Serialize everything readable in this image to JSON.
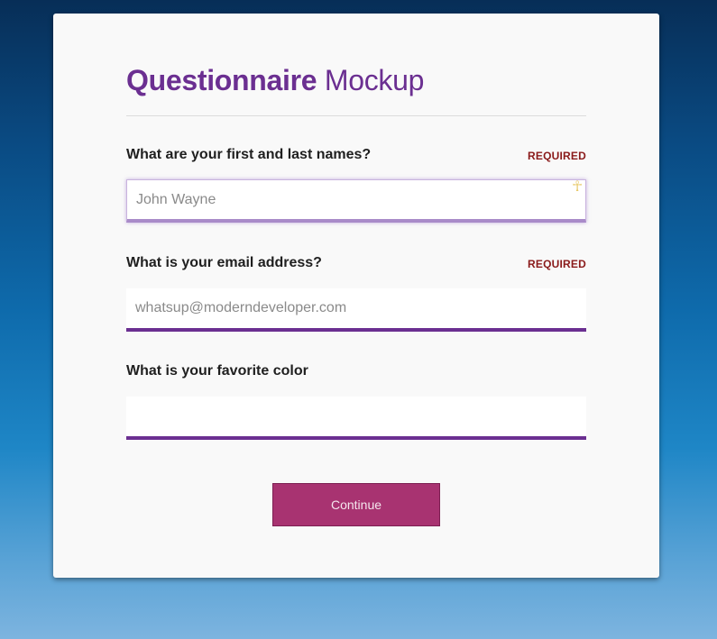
{
  "form": {
    "title_bold": "Questionnaire",
    "title_light": "Mockup",
    "questions": [
      {
        "label": "What are your first and last names?",
        "required_label": "REQUIRED",
        "placeholder": "John Wayne",
        "value": ""
      },
      {
        "label": "What is your email address?",
        "required_label": "REQUIRED",
        "placeholder": "whatsup@moderndeveloper.com",
        "value": ""
      },
      {
        "label": "What is your favorite color",
        "placeholder": "",
        "value": ""
      }
    ],
    "continue_label": "Continue"
  },
  "colors": {
    "accent": "#6b2f91",
    "button": "#a83371",
    "required": "#8a1a1a"
  },
  "icons": {
    "field_icon": "ankh-icon"
  }
}
